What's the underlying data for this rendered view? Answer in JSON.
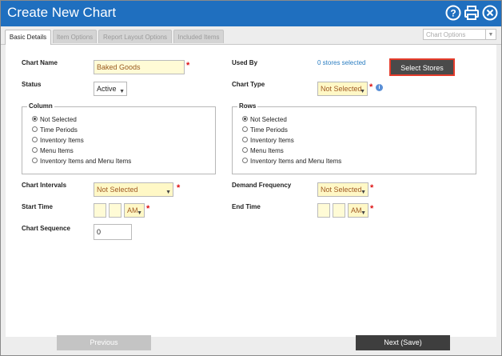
{
  "window": {
    "title": "Create New Chart"
  },
  "tabs": [
    {
      "label": "Basic Details",
      "active": true
    },
    {
      "label": "Item Options",
      "active": false
    },
    {
      "label": "Report Layout Options",
      "active": false
    },
    {
      "label": "Included Items",
      "active": false
    }
  ],
  "chart_options": {
    "label": "Chart Options"
  },
  "form": {
    "chart_name": {
      "label": "Chart Name",
      "value": "Baked Goods"
    },
    "status": {
      "label": "Status",
      "value": "Active"
    },
    "used_by": {
      "label": "Used By",
      "value": "0 stores selected"
    },
    "select_stores": "Select Stores",
    "chart_type": {
      "label": "Chart Type",
      "value": "Not Selected"
    },
    "column_group": {
      "title": "Column",
      "options": [
        "Not Selected",
        "Time Periods",
        "Inventory Items",
        "Menu Items",
        "Inventory Items and Menu Items"
      ],
      "selected": 0
    },
    "rows_group": {
      "title": "Rows",
      "options": [
        "Not Selected",
        "Time Periods",
        "Inventory Items",
        "Menu Items",
        "Inventory Items and Menu Items"
      ],
      "selected": 0
    },
    "chart_intervals": {
      "label": "Chart Intervals",
      "value": "Not Selected"
    },
    "demand_frequency": {
      "label": "Demand Frequency",
      "value": "Not Selected"
    },
    "start_time": {
      "label": "Start Time",
      "ampm": "AM"
    },
    "end_time": {
      "label": "End Time",
      "ampm": "AM"
    },
    "chart_sequence": {
      "label": "Chart Sequence",
      "value": "0"
    }
  },
  "footer": {
    "previous": "Previous",
    "next": "Next (Save)"
  },
  "colors": {
    "titlebar": "#1f6fbf",
    "required": "#dd1111",
    "highlight": "#e43b2b"
  }
}
